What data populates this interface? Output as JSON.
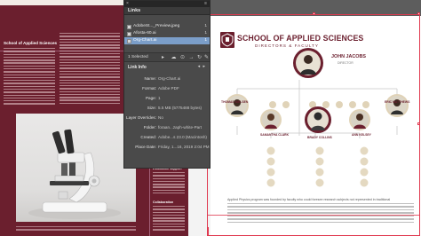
{
  "left_page": {
    "heading_school": "School of Applied Sciences",
    "side_heading_1": "Focused on the future",
    "side_heading_2": "Excerpt signature",
    "side_heading_3": "Outreach",
    "side_heading_4": "Evaluation support",
    "side_heading_5": "Collaboration"
  },
  "links_panel": {
    "close_glyph": "×",
    "menu_glyph": "≡",
    "tab_label": "Links",
    "links": [
      {
        "name": "AdobeSt..._Preview.jpeg",
        "page": "1"
      },
      {
        "name": "Afosta-60.ai",
        "page": "1"
      },
      {
        "name": "Org-Chart.ai",
        "page": "1"
      }
    ],
    "status_text": "1 Selected",
    "info_header": "Link Info",
    "info_nav": "◂ ▸",
    "info": [
      {
        "key": "Name:",
        "value": "Org-Chart.ai"
      },
      {
        "key": "Format:",
        "value": "Adobe PDF"
      },
      {
        "key": "Page:",
        "value": "1"
      },
      {
        "key": "Size:",
        "value": "5.5 MB (5775488 bytes)"
      },
      {
        "key": "Layer Overrides:",
        "value": "No"
      },
      {
        "key": "Folder:",
        "value": "foraan...zaph-white-Part"
      },
      {
        "key": "Created:",
        "value": "Adobe...s 23.0 (Macintosh)"
      },
      {
        "key": "Place Date:",
        "value": "Friday, 1...16, 2019 2:04 PM"
      }
    ],
    "colors": {
      "selected": "#7b9ec9",
      "panel": "#4a4a4a"
    }
  },
  "org_chart": {
    "title": "SCHOOL OF APPLIED SCIENCES",
    "subtitle": "DIRECTORS & FACULTY",
    "top": {
      "name": "JOHN JACOBS",
      "role": "DIRECTOR"
    },
    "level2_names": [
      "THOMAS NIELSEN",
      "ERIC MATTHEWS"
    ],
    "level3_names": [
      "SAMANTHA CLARK",
      "BRADY COLLINS",
      "ANN KELSEY"
    ],
    "brand_color": "#6b1f2e",
    "accent_color": "#e0d3b8"
  },
  "bottom_paragraph": {
    "first_line": "Applied Physics program was founded by faculty who could foresee research subjects not represented in traditional"
  },
  "selection_color": "#e0384f"
}
